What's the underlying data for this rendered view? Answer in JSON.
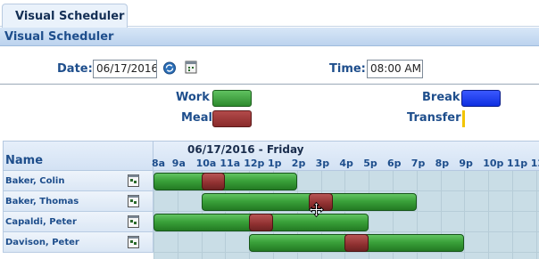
{
  "tab": {
    "label": "Visual Scheduler"
  },
  "section": {
    "title": "Visual Scheduler"
  },
  "params": {
    "date_label": "Date:",
    "date_value": "06/17/2016",
    "time_label": "Time:",
    "time_value": "08:00 AM"
  },
  "legend": {
    "work": "Work",
    "meal": "Meal",
    "break": "Break",
    "transfer": "Transfer"
  },
  "colors": {
    "work": "#3aa13a",
    "meal": "#8f3030",
    "break": "#1a3cff",
    "transfer": "#f2c400"
  },
  "grid": {
    "name_header": "Name",
    "date_title": "06/17/2016 - Friday",
    "hours": [
      "8a",
      "9a",
      "10a",
      "11a",
      "12p",
      "1p",
      "2p",
      "3p",
      "4p",
      "5p",
      "6p",
      "7p",
      "8p",
      "9p",
      "10p",
      "11p",
      "12"
    ],
    "rows": [
      {
        "name": "Baker, Colin",
        "work": [
          "8a",
          "2p"
        ],
        "meal": [
          "10a",
          "11a"
        ]
      },
      {
        "name": "Baker, Thomas",
        "work": [
          "10a",
          "7p"
        ],
        "meal": [
          "2:30p",
          "3:30p"
        ]
      },
      {
        "name": "Capaldi, Peter",
        "work": [
          "8a",
          "5p"
        ],
        "meal": [
          "12p",
          "1p"
        ]
      },
      {
        "name": "Davison, Peter",
        "work": [
          "12p",
          "9p"
        ],
        "meal": [
          "4p",
          "5p"
        ]
      }
    ]
  }
}
